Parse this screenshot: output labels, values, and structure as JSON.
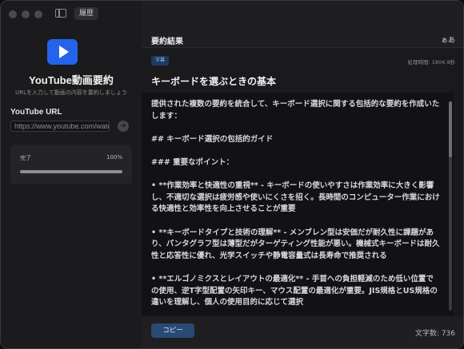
{
  "sidebar": {
    "history_label": "履歴",
    "app_title": "YouTube動画要約",
    "app_subtitle": "URLを入力して動画の内容を要約しましょう",
    "url_label": "YouTube URL",
    "url_placeholder": "https://www.youtube.com/watch",
    "progress": {
      "label": "完了",
      "percent_text": "100%",
      "fraction": 1.0
    }
  },
  "main": {
    "title": "要約結果",
    "font_toggle": "ぁあ",
    "tag": "字幕",
    "processing_time": "処理時間: 1804.9秒",
    "video_title": "キーボードを選ぶときの基本",
    "summary_paragraphs": [
      "提供された複数の要約を統合して、キーボード選択に関する包括的な要約を作成いたします：",
      "## キーボード選択の包括的ガイド",
      "### 重要なポイント：",
      "• **作業効率と快適性の重視** - キーボードの使いやすさは作業効率に大きく影響し、不適切な選択は疲労感や使いにくさを招く。長時間のコンピューター作業における快適性と効率性を向上させることが重要",
      "• **キーボードタイプと技術の理解** - メンブレン型は安価だが耐久性に課題があり、パンタグラフ型は薄型だがターゲティング性能が悪い。機械式キーボードは耐久性と応答性に優れ、光学スイッチや静電容量式は長寿命で推奨される",
      "• **エルゴノミクスとレイアウトの最適化** - 手首への負担軽減のため低い位置での使用、逆T字型配置の矢印キー、マウス配置の最適化が重要。JIS規格とUS規格の違いを理解し、個人の使用目的に応じて選択"
    ],
    "copy_label": "コピー",
    "char_count": "文字数: 736"
  }
}
